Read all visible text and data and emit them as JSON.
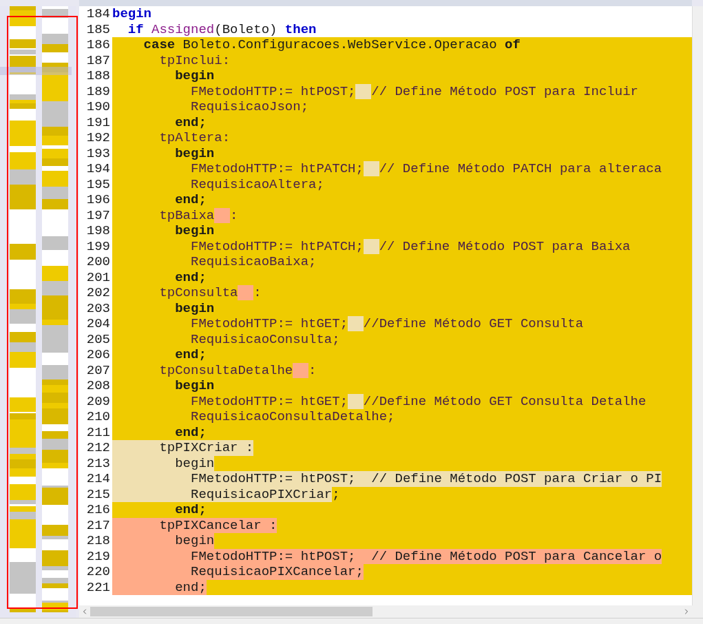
{
  "editor": {
    "lines": [
      {
        "number": "184",
        "changed": false,
        "segments": [
          {
            "text": "begin",
            "kind": "kw"
          }
        ]
      },
      {
        "number": "185",
        "changed": false,
        "segments": [
          {
            "text": "  if",
            "kind": "kw"
          },
          {
            "text": " Assigned",
            "kind": "fn"
          },
          {
            "text": "(Boleto)",
            "kind": "text"
          },
          {
            "text": " then",
            "kind": "kw"
          }
        ]
      },
      {
        "number": "186",
        "changed": true,
        "segments": [
          {
            "text": "    case",
            "kind": "kw"
          },
          {
            "text": " Boleto.Configuracoes.WebService.Operacao",
            "kind": "text"
          },
          {
            "text": " of",
            "kind": "kw"
          }
        ]
      },
      {
        "number": "187",
        "changed": true,
        "segments": [
          {
            "text": "      tpInclui:",
            "kind": "fn"
          }
        ]
      },
      {
        "number": "188",
        "changed": true,
        "segments": [
          {
            "text": "        begin",
            "kind": "kw"
          }
        ]
      },
      {
        "number": "189",
        "changed": true,
        "segments": [
          {
            "text": "          FMetodoHTTP:= htPOST;",
            "kind": "fn"
          },
          {
            "kind": "mark",
            "color": "#f0e0b0"
          },
          {
            "text": "// Define Método POST para Incluir",
            "kind": "fn"
          }
        ]
      },
      {
        "number": "190",
        "changed": true,
        "segments": [
          {
            "text": "          RequisicaoJson;",
            "kind": "fn"
          }
        ]
      },
      {
        "number": "191",
        "changed": true,
        "segments": [
          {
            "text": "        end;",
            "kind": "kw"
          }
        ]
      },
      {
        "number": "192",
        "changed": true,
        "segments": [
          {
            "text": "      tpAltera:",
            "kind": "fn"
          }
        ]
      },
      {
        "number": "193",
        "changed": true,
        "segments": [
          {
            "text": "        begin",
            "kind": "kw"
          }
        ]
      },
      {
        "number": "194",
        "changed": true,
        "segments": [
          {
            "text": "          FMetodoHTTP:= htPATCH;",
            "kind": "fn"
          },
          {
            "kind": "mark",
            "color": "#f0e0b0"
          },
          {
            "text": "// Define Método PATCH para alteraca",
            "kind": "fn"
          }
        ]
      },
      {
        "number": "195",
        "changed": true,
        "segments": [
          {
            "text": "          RequisicaoAltera;",
            "kind": "fn"
          }
        ]
      },
      {
        "number": "196",
        "changed": true,
        "segments": [
          {
            "text": "        end;",
            "kind": "kw"
          }
        ]
      },
      {
        "number": "197",
        "changed": true,
        "segments": [
          {
            "text": "      tpBaixa",
            "kind": "fn"
          },
          {
            "kind": "mark",
            "color": "#ffab88"
          },
          {
            "text": ":",
            "kind": "fn"
          }
        ]
      },
      {
        "number": "198",
        "changed": true,
        "segments": [
          {
            "text": "        begin",
            "kind": "kw"
          }
        ]
      },
      {
        "number": "199",
        "changed": true,
        "segments": [
          {
            "text": "          FMetodoHTTP:= htPATCH;",
            "kind": "fn"
          },
          {
            "kind": "mark",
            "color": "#f0e0b0"
          },
          {
            "text": "// Define Método POST para Baixa",
            "kind": "fn"
          }
        ]
      },
      {
        "number": "200",
        "changed": true,
        "segments": [
          {
            "text": "          RequisicaoBaixa;",
            "kind": "fn"
          }
        ]
      },
      {
        "number": "201",
        "changed": true,
        "segments": [
          {
            "text": "        end;",
            "kind": "kw"
          }
        ]
      },
      {
        "number": "202",
        "changed": true,
        "segments": [
          {
            "text": "      tpConsulta",
            "kind": "fn"
          },
          {
            "kind": "mark",
            "color": "#ffab88"
          },
          {
            "text": ":",
            "kind": "fn"
          }
        ]
      },
      {
        "number": "203",
        "changed": true,
        "segments": [
          {
            "text": "        begin",
            "kind": "kw"
          }
        ]
      },
      {
        "number": "204",
        "changed": true,
        "segments": [
          {
            "text": "          FMetodoHTTP:= htGET;",
            "kind": "fn"
          },
          {
            "kind": "mark",
            "color": "#f0e0b0"
          },
          {
            "text": "//Define Método GET Consulta",
            "kind": "fn"
          }
        ]
      },
      {
        "number": "205",
        "changed": true,
        "segments": [
          {
            "text": "          RequisicaoConsulta;",
            "kind": "fn"
          }
        ]
      },
      {
        "number": "206",
        "changed": true,
        "segments": [
          {
            "text": "        end;",
            "kind": "kw"
          }
        ]
      },
      {
        "number": "207",
        "changed": true,
        "segments": [
          {
            "text": "      tpConsultaDetalhe",
            "kind": "fn"
          },
          {
            "kind": "mark",
            "color": "#ffab88"
          },
          {
            "text": ":",
            "kind": "fn"
          }
        ]
      },
      {
        "number": "208",
        "changed": true,
        "segments": [
          {
            "text": "        begin",
            "kind": "kw"
          }
        ]
      },
      {
        "number": "209",
        "changed": true,
        "segments": [
          {
            "text": "          FMetodoHTTP:= htGET;",
            "kind": "fn"
          },
          {
            "kind": "mark",
            "color": "#f0e0b0"
          },
          {
            "text": "//Define Método GET Consulta Detalhe",
            "kind": "fn"
          }
        ]
      },
      {
        "number": "210",
        "changed": true,
        "segments": [
          {
            "text": "          RequisicaoConsultaDetalhe;",
            "kind": "fn"
          }
        ]
      },
      {
        "number": "211",
        "changed": true,
        "segments": [
          {
            "text": "        end;",
            "kind": "kw"
          }
        ]
      },
      {
        "number": "212",
        "changed": true,
        "segments": [
          {
            "text": "      tpPIXCriar :",
            "kind": "text",
            "color": "#f0e0b0"
          }
        ]
      },
      {
        "number": "213",
        "changed": true,
        "segments": [
          {
            "text": "        begin",
            "kind": "text",
            "color": "#f0e0b0"
          }
        ]
      },
      {
        "number": "214",
        "changed": true,
        "segments": [
          {
            "text": "          FMetodoHTTP:=",
            "kind": "text",
            "color": "#f0e0b0"
          },
          {
            "text": " htPOST;  //",
            "kind": "text",
            "color": "#f0e0b0"
          },
          {
            "text": " Define Método POST para Criar o PI",
            "kind": "text",
            "color": "#f0e0b0"
          }
        ]
      },
      {
        "number": "215",
        "changed": true,
        "segments": [
          {
            "text": "          RequisicaoPIXCriar",
            "kind": "text",
            "color": "#f0e0b0"
          },
          {
            "text": ";",
            "kind": "text"
          }
        ]
      },
      {
        "number": "216",
        "changed": true,
        "segments": [
          {
            "text": "        end;",
            "kind": "kw"
          }
        ]
      },
      {
        "number": "217",
        "changed": true,
        "segments": [
          {
            "text": "      tpPIXCancelar :",
            "kind": "text",
            "color": "#ffab88"
          }
        ]
      },
      {
        "number": "218",
        "changed": true,
        "segments": [
          {
            "text": "        begin",
            "kind": "text",
            "color": "#ffab88"
          }
        ]
      },
      {
        "number": "219",
        "changed": true,
        "segments": [
          {
            "text": "          FMetodoHTTP:= htPOST;  // Define Método POST para Cancelar o",
            "kind": "text",
            "color": "#ffab88"
          }
        ]
      },
      {
        "number": "220",
        "changed": true,
        "segments": [
          {
            "text": "          RequisicaoPIXCancelar;",
            "kind": "text",
            "color": "#ffab88"
          }
        ]
      },
      {
        "number": "221",
        "changed": true,
        "segments": [
          {
            "text": "        end;",
            "kind": "text",
            "color": "#ffab88"
          }
        ]
      }
    ]
  }
}
